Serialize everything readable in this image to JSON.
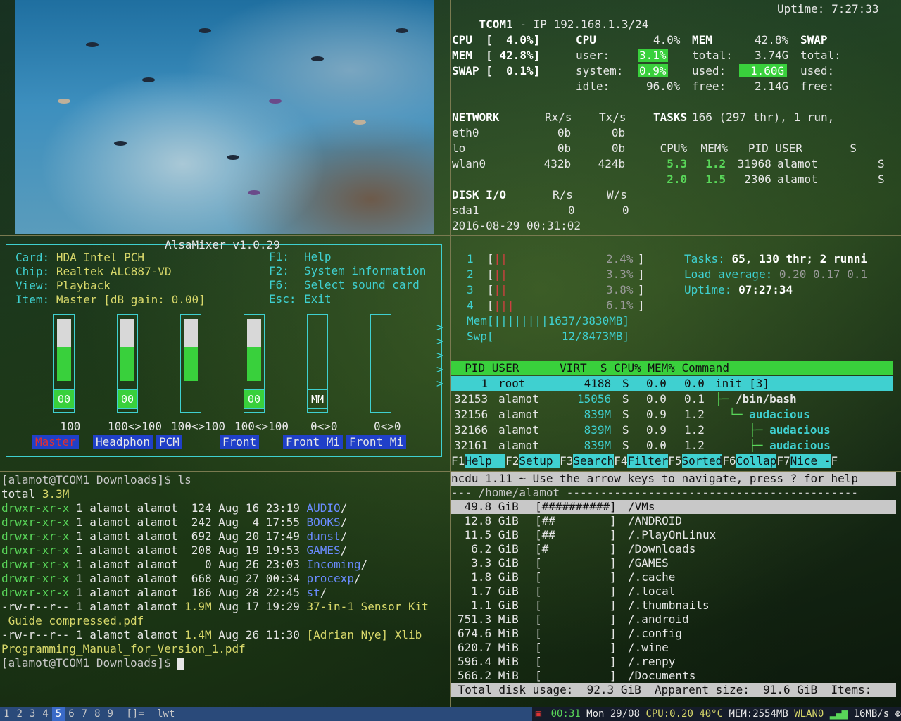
{
  "glances": {
    "host": "TCOM1",
    "ip_label": "- IP",
    "ip": "192.168.1.3/24",
    "uptime": "Uptime: 7:27:33",
    "cpu_row": "CPU  [  4.0%]",
    "mem_row": "MEM  [ 42.8%]",
    "swap_row": "SWAP [  0.1%]",
    "cpu_title": "CPU",
    "cpu_total": "4.0%",
    "cpu_user_label": "user:",
    "cpu_user": "3.1%",
    "cpu_system_label": "system:",
    "cpu_system": "0.9%",
    "cpu_idle_label": "idle:",
    "cpu_idle": "96.0%",
    "mem_title": "MEM",
    "mem_pct": "42.8%",
    "mem_total_label": "total:",
    "mem_total": "3.74G",
    "mem_used_label": "used:",
    "mem_used": "1.60G",
    "mem_free_label": "free:",
    "mem_free": "2.14G",
    "swap_title": "SWAP",
    "swap_total_label": "total:",
    "swap_used_label": "used:",
    "swap_free_label": "free:",
    "network_header": "NETWORK",
    "rx_header": "Rx/s",
    "tx_header": "Tx/s",
    "net": [
      {
        "iface": "eth0",
        "rx": "0b",
        "tx": "0b"
      },
      {
        "iface": "lo",
        "rx": "0b",
        "tx": "0b"
      },
      {
        "iface": "wlan0",
        "rx": "432b",
        "tx": "424b"
      }
    ],
    "tasks_label": "TASKS",
    "tasks": "166 (297 thr), 1 run,",
    "proc_header": " CPU%  MEM%   PID USER       S",
    "procs": [
      {
        "cpu": "5.3",
        "mem": "1.2",
        "pid": "31968",
        "user": "alamot",
        "s": "S"
      },
      {
        "cpu": "2.0",
        "mem": "1.5",
        "pid": "2306",
        "user": "alamot",
        "s": "S"
      }
    ],
    "disk_header": "DISK I/O",
    "r_header": "R/s",
    "w_header": "W/s",
    "disk": {
      "dev": "sda1",
      "r": "0",
      "w": "0"
    },
    "datetime": "2016-08-29 00:31:02"
  },
  "alsamixer": {
    "title": "AlsaMixer v1.0.29",
    "card_label": "Card:",
    "card": "HDA Intel PCH",
    "chip_label": "Chip:",
    "chip": "Realtek ALC887-VD",
    "view_label": "View:",
    "view": "Playback",
    "item_label": "Item:",
    "item": "Master [dB gain: 0.00]",
    "keys": [
      {
        "key": "F1:",
        "desc": "Help"
      },
      {
        "key": "F2:",
        "desc": "System information"
      },
      {
        "key": "F6:",
        "desc": "Select sound card"
      },
      {
        "key": "Esc:",
        "desc": "Exit"
      }
    ],
    "channels": [
      {
        "name": "Master",
        "value": "100",
        "box": "00",
        "level": 1.0
      },
      {
        "name": "Headphon",
        "value": "100<>100",
        "box": "00",
        "level": 1.0
      },
      {
        "name": "PCM",
        "value": "100<>100",
        "box": "",
        "level": 1.0
      },
      {
        "name": "Front",
        "value": "100<>100",
        "box": "00",
        "level": 1.0
      },
      {
        "name": "Front Mi",
        "value": "0<>0",
        "box": "MM",
        "level": 0
      },
      {
        "name": "Front Mi",
        "value": "0<>0",
        "box": "",
        "level": 0
      }
    ]
  },
  "htop": {
    "cpus": [
      {
        "n": "1",
        "pct": "2.4%"
      },
      {
        "n": "2",
        "pct": "3.3%"
      },
      {
        "n": "3",
        "pct": "3.8%"
      },
      {
        "n": "4",
        "pct": "6.1%"
      }
    ],
    "mem": "Mem[||||||||1637/3830MB]",
    "swp": "Swp[          12/8473MB]",
    "tasks_label": "Tasks:",
    "tasks_val": "65, 130 thr; 2 runni",
    "load_label": "Load average:",
    "load_val": "0.20 0.17 0.1",
    "uptime_label": "Uptime:",
    "uptime_val": "07:27:34",
    "header": "  PID USER      VIRT  S CPU% MEM% Command",
    "rows": [
      {
        "pid": "1",
        "user": "root",
        "virt": "4188",
        "s": "S",
        "cpu": "0.0",
        "mem": "0.0",
        "cmd": "init [3]"
      },
      {
        "pid": "32153",
        "user": "alamot",
        "virt": "15056",
        "s": "S",
        "cpu": "0.0",
        "mem": "0.1",
        "cmd": "/bin/bash"
      },
      {
        "pid": "32156",
        "user": "alamot",
        "virt": "839M",
        "s": "S",
        "cpu": "0.9",
        "mem": "1.2",
        "cmd": "audacious"
      },
      {
        "pid": "32166",
        "user": "alamot",
        "virt": "839M",
        "s": "S",
        "cpu": "0.9",
        "mem": "1.2",
        "cmd": "audacious"
      },
      {
        "pid": "32161",
        "user": "alamot",
        "virt": "839M",
        "s": "S",
        "cpu": "0.0",
        "mem": "1.2",
        "cmd": "audacious"
      }
    ],
    "fkeys": [
      {
        "k": "F1",
        "l": "Help  "
      },
      {
        "k": "F2",
        "l": "Setup "
      },
      {
        "k": "F3",
        "l": "Search"
      },
      {
        "k": "F4",
        "l": "Filter"
      },
      {
        "k": "F5",
        "l": "Sorted"
      },
      {
        "k": "F6",
        "l": "Collap"
      },
      {
        "k": "F7",
        "l": "Nice -"
      },
      {
        "k": "F",
        "l": ""
      }
    ]
  },
  "terminal": {
    "prompt1": "[alamot@TCOM1 Downloads]$ ls",
    "total_label": "total",
    "total": "3.3M",
    "files": [
      {
        "perm": "drwxr-xr-x",
        "size": "124",
        "date": "Aug 16 23:19",
        "name": "AUDIO",
        "suf": "/"
      },
      {
        "perm": "drwxr-xr-x",
        "size": "242",
        "date": "Aug  4 17:55",
        "name": "BOOKS",
        "suf": "/"
      },
      {
        "perm": "drwxr-xr-x",
        "size": "692",
        "date": "Aug 20 17:49",
        "name": "dunst",
        "suf": "/"
      },
      {
        "perm": "drwxr-xr-x",
        "size": "208",
        "date": "Aug 19 19:53",
        "name": "GAMES",
        "suf": "/"
      },
      {
        "perm": "drwxr-xr-x",
        "size": "  0",
        "date": "Aug 26 23:03",
        "name": "Incoming",
        "suf": "/"
      },
      {
        "perm": "drwxr-xr-x",
        "size": "668",
        "date": "Aug 27 00:34",
        "name": "procexp",
        "suf": "/"
      },
      {
        "perm": "drwxr-xr-x",
        "size": "186",
        "date": "Aug 28 22:45",
        "name": "st",
        "suf": "/"
      }
    ],
    "file1_perm": "-rw-r--r--",
    "file1_size": "1.9M",
    "file1_date": "Aug 17 19:29",
    "file1_name": "37-in-1 Sensor Kit",
    "file1_cont": " Guide_compressed.pdf",
    "file2_perm": "-rw-r--r--",
    "file2_size": "1.4M",
    "file2_date": "Aug 26 11:30",
    "file2_name": "[Adrian_Nye]_Xlib_",
    "file2_cont": "Programming_Manual_for_Version_1.pdf",
    "owner": "1 alamot alamot",
    "prompt2": "[alamot@TCOM1 Downloads]$ "
  },
  "ncdu": {
    "header": "ncdu 1.11 ~ Use the arrow keys to navigate, press ? for help",
    "path": "--- /home/alamot -------------------------------------------",
    "entries": [
      {
        "size": "49.8 GiB",
        "bar": "[##########]",
        "name": "/VMs"
      },
      {
        "size": "12.8 GiB",
        "bar": "[##        ]",
        "name": "/ANDROID"
      },
      {
        "size": "11.5 GiB",
        "bar": "[##        ]",
        "name": "/.PlayOnLinux"
      },
      {
        "size": " 6.2 GiB",
        "bar": "[#         ]",
        "name": "/Downloads"
      },
      {
        "size": " 3.3 GiB",
        "bar": "[          ]",
        "name": "/GAMES"
      },
      {
        "size": " 1.8 GiB",
        "bar": "[          ]",
        "name": "/.cache"
      },
      {
        "size": " 1.7 GiB",
        "bar": "[          ]",
        "name": "/.local"
      },
      {
        "size": " 1.1 GiB",
        "bar": "[          ]",
        "name": "/.thumbnails"
      },
      {
        "size": "751.3 MiB",
        "bar": "[          ]",
        "name": "/.android"
      },
      {
        "size": "674.6 MiB",
        "bar": "[          ]",
        "name": "/.config"
      },
      {
        "size": "620.7 MiB",
        "bar": "[          ]",
        "name": "/.wine"
      },
      {
        "size": "596.4 MiB",
        "bar": "[          ]",
        "name": "/.renpy"
      },
      {
        "size": "566.2 MiB",
        "bar": "[          ]",
        "name": "/Documents"
      }
    ],
    "footer": " Total disk usage:  92.3 GiB  Apparent size:  91.6 GiB  Items:"
  },
  "statusbar": {
    "tags": [
      "1",
      "2",
      "3",
      "4",
      "5",
      "6",
      "7",
      "8",
      "9"
    ],
    "current_tag": "5",
    "layout": "[]=",
    "title": "lwt",
    "time": "00:31",
    "date": "Mon 29/08",
    "cpu": "CPU:0.20",
    "temp": "40°C",
    "mem": "MEM:2554MB",
    "wlan": "WLAN0",
    "net": "16MB/s"
  }
}
